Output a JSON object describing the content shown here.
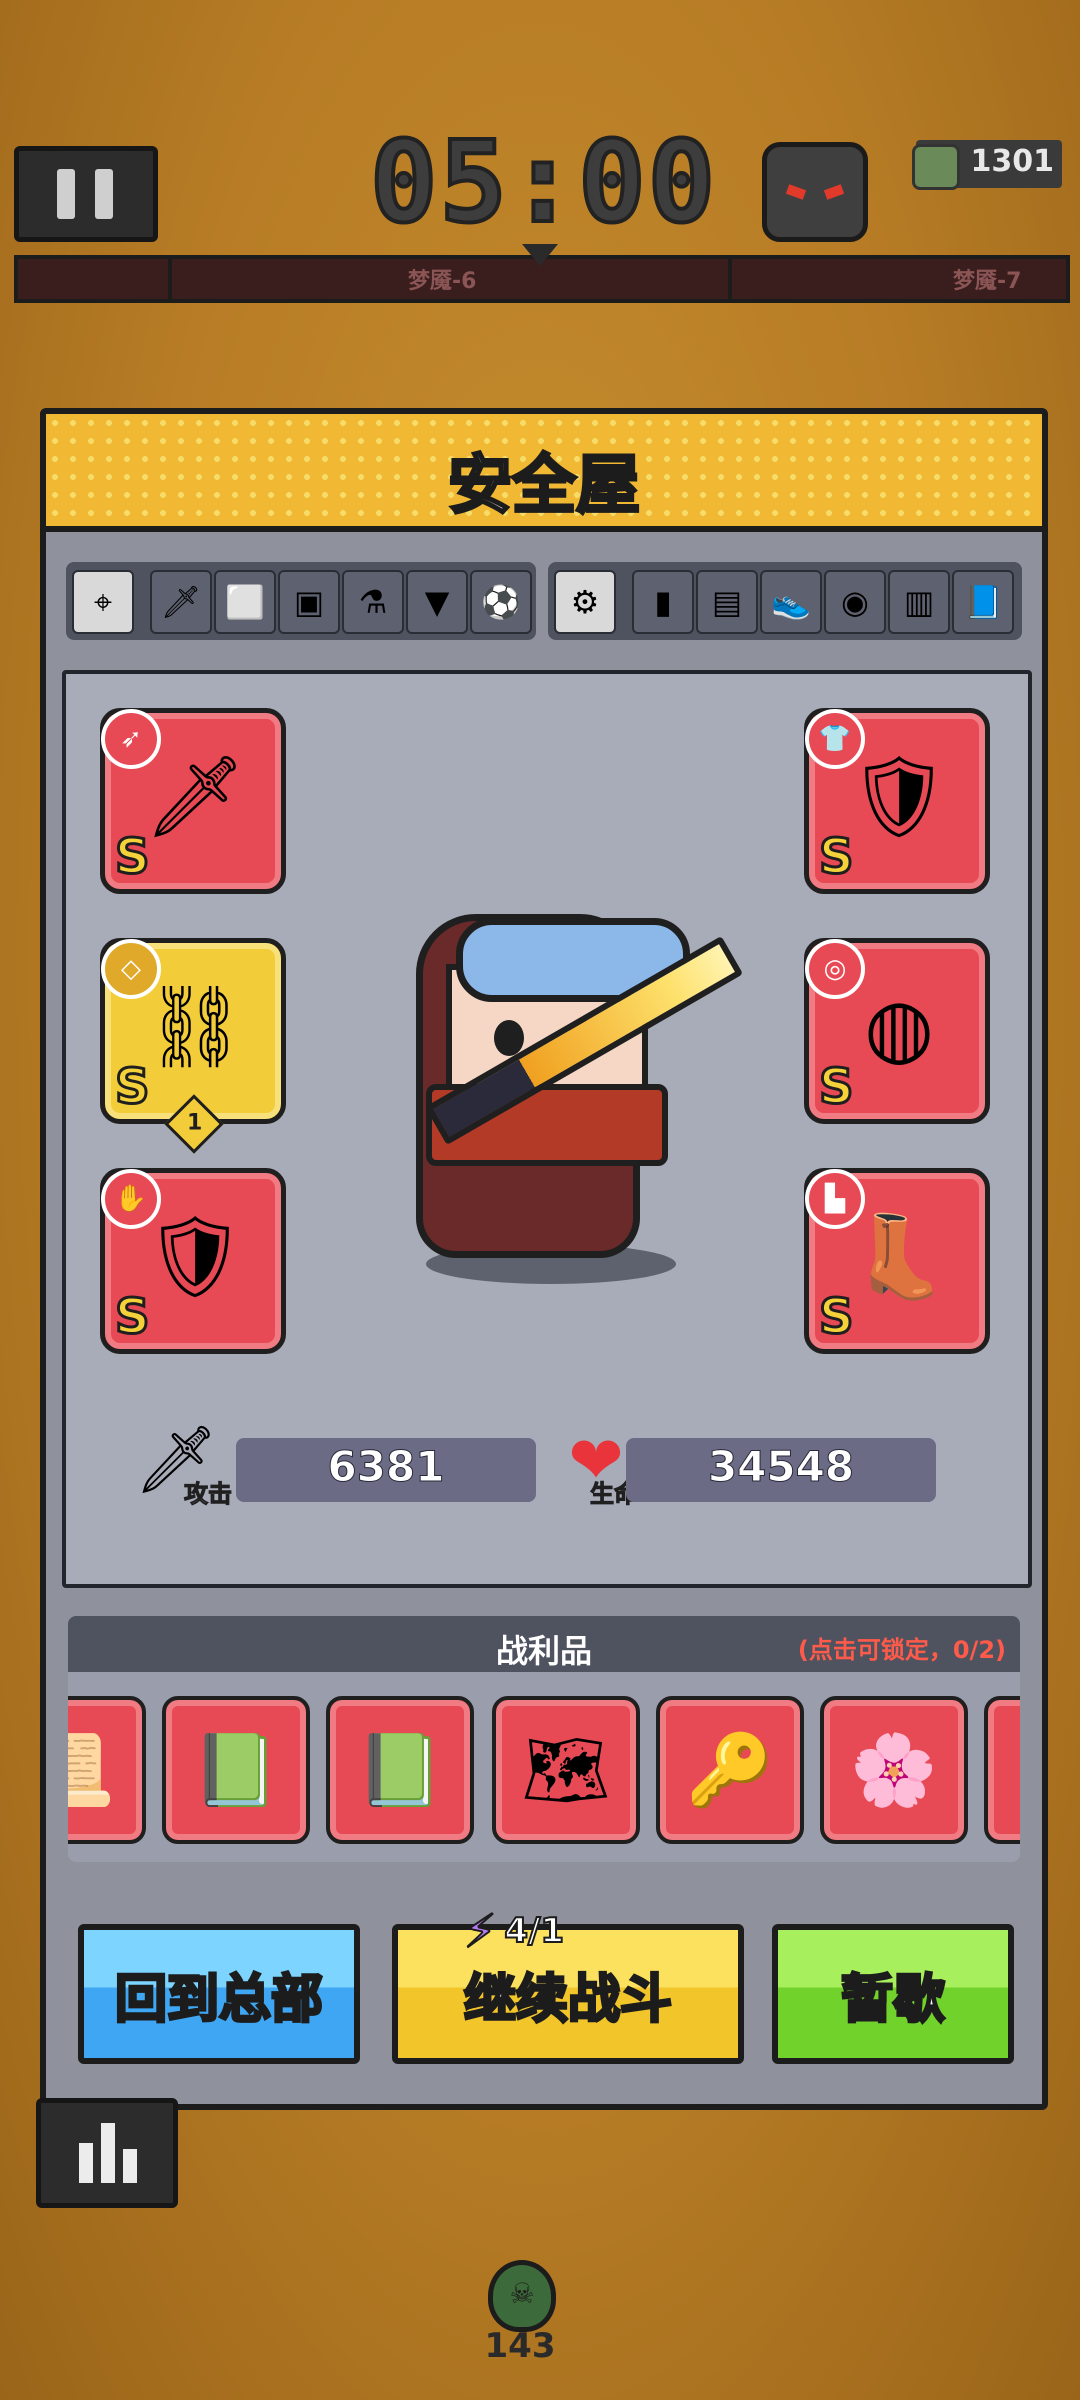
{
  "hud": {
    "timer": "05:00",
    "coins": "1301",
    "waves": [
      "梦魇-6",
      "梦魇-7"
    ]
  },
  "modal": {
    "title": "安全屋",
    "tabs_left": [
      "target-icon",
      "blade-icon",
      "robot-icon",
      "camera-icon",
      "potion-icon",
      "drill-icon",
      "soccer-ball-icon"
    ],
    "tabs_right": [
      "gear-tab-icon",
      "battery-icon",
      "cassette-icon",
      "sneaker-icon",
      "mine-icon",
      "vest-icon",
      "book-icon"
    ],
    "equipment": {
      "left": [
        {
          "slot": "weapon",
          "rank": "S",
          "icon": "sword-icon"
        },
        {
          "slot": "necklace",
          "rank": "S",
          "icon": "chain-necklace-icon",
          "level": "1"
        },
        {
          "slot": "gloves",
          "rank": "S",
          "icon": "gauntlet-icon"
        }
      ],
      "right": [
        {
          "slot": "armor",
          "rank": "S",
          "icon": "armor-icon"
        },
        {
          "slot": "belt",
          "rank": "S",
          "icon": "belt-icon"
        },
        {
          "slot": "boots",
          "rank": "S",
          "icon": "boots-icon"
        }
      ]
    },
    "stats": {
      "attack_label": "攻击",
      "attack_value": "6381",
      "hp_label": "生命",
      "hp_value": "34548"
    },
    "loot": {
      "title": "战利品",
      "hint": "(点击可锁定，0/2)",
      "items": [
        "scroll-icon",
        "spellbook-icon",
        "spellbook-icon",
        "blueprint-icon",
        "key-icon",
        "flower-icon",
        "partial-item-icon"
      ]
    },
    "buttons": {
      "return": "回到总部",
      "continue": "继续战斗",
      "energy": "4/1",
      "rest": "暂歇"
    }
  },
  "bottom": {
    "kill_count": "143"
  }
}
